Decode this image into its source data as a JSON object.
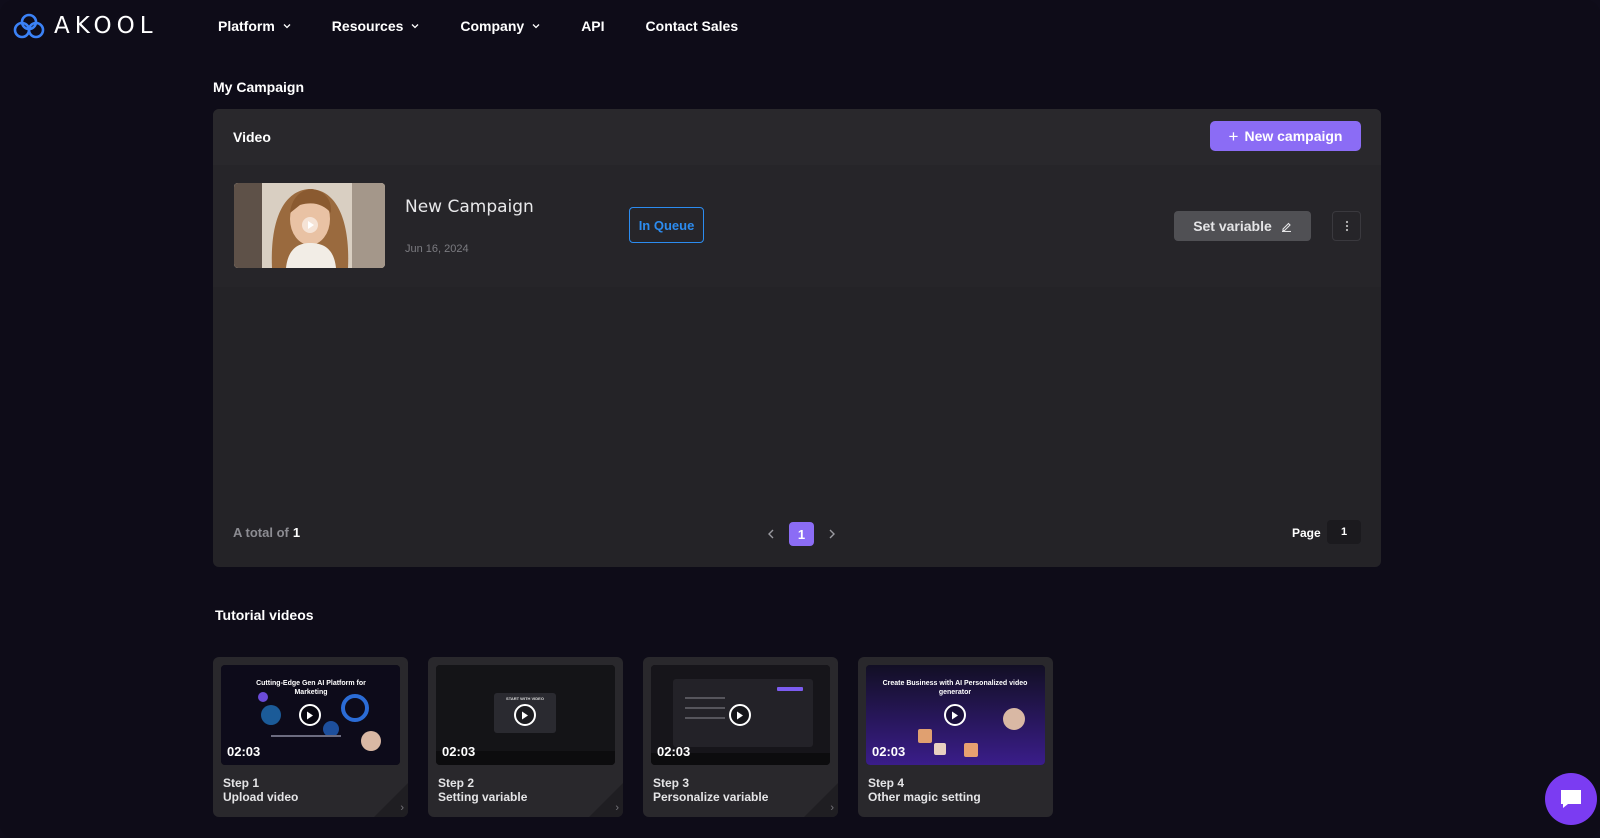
{
  "brand": {
    "name": "AKOOL",
    "accent": "#8b6cf5",
    "logo_blue": "#3b82f6"
  },
  "nav": {
    "items": [
      {
        "label": "Platform",
        "dropdown": true
      },
      {
        "label": "Resources",
        "dropdown": true
      },
      {
        "label": "Company",
        "dropdown": true
      },
      {
        "label": "API",
        "dropdown": false
      },
      {
        "label": "Contact Sales",
        "dropdown": false
      }
    ]
  },
  "campaign": {
    "section_title": "My Campaign",
    "panel_title": "Video",
    "new_button": "New campaign",
    "rows": [
      {
        "name": "New Campaign",
        "date": "Jun 16, 2024",
        "status": "In Queue",
        "action": "Set variable"
      }
    ],
    "total_label": "A total of",
    "total_count": "1",
    "current_page": "1",
    "page_label": "Page",
    "page_value": "1"
  },
  "tutorials": {
    "section_title": "Tutorial videos",
    "cards": [
      {
        "step": "Step 1",
        "title": "Upload video",
        "duration": "02:03",
        "preview_heading": "Cutting-Edge Gen AI Platform for Marketing"
      },
      {
        "step": "Step 2",
        "title": "Setting variable",
        "duration": "02:03",
        "preview_heading": "START WITH VIDEO"
      },
      {
        "step": "Step 3",
        "title": "Personalize variable",
        "duration": "02:03",
        "preview_heading": ""
      },
      {
        "step": "Step 4",
        "title": "Other magic setting",
        "duration": "02:03",
        "preview_heading": "Create Business with AI Personalized video generator"
      }
    ]
  },
  "icons": {
    "logo": "akool-logo-icon",
    "chevron": "chevron-down-icon",
    "edit": "edit-icon",
    "more": "more-vertical-icon",
    "chat": "chat-icon"
  }
}
